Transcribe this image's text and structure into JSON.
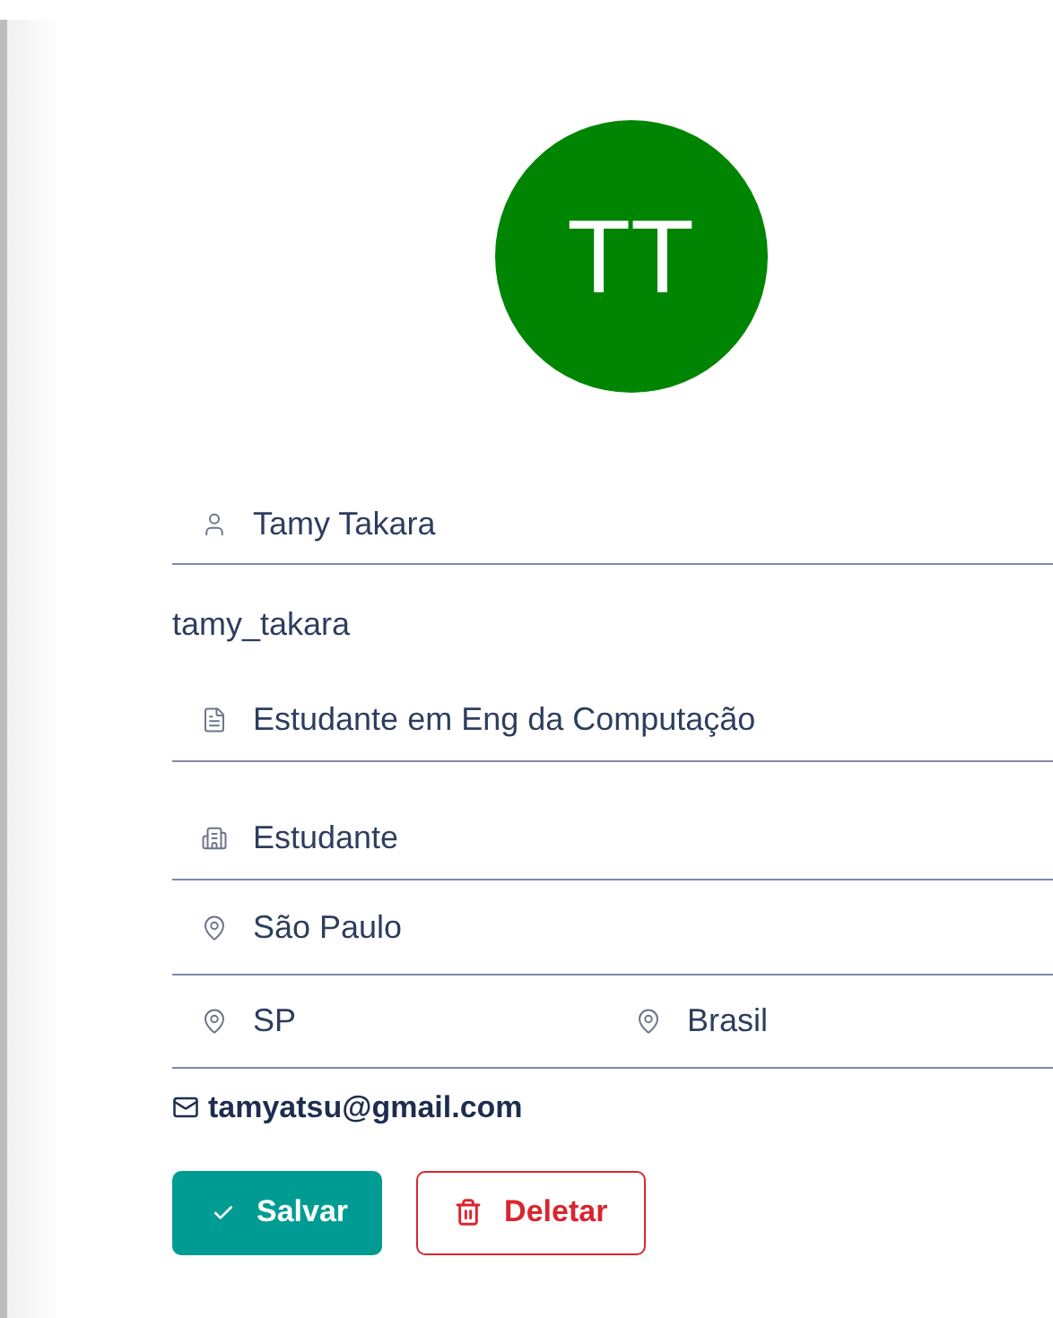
{
  "avatar": {
    "initials": "TT",
    "color": "#008502"
  },
  "profile": {
    "name": "Tamy Takara",
    "username": "tamy_takara",
    "occupation": "Estudante em Eng da Computação",
    "company": "Estudante",
    "city": "São Paulo",
    "state": "SP",
    "country": "Brasil",
    "email": "tamyatsu@gmail.com"
  },
  "buttons": {
    "save": "Salvar",
    "delete": "Deletar"
  }
}
